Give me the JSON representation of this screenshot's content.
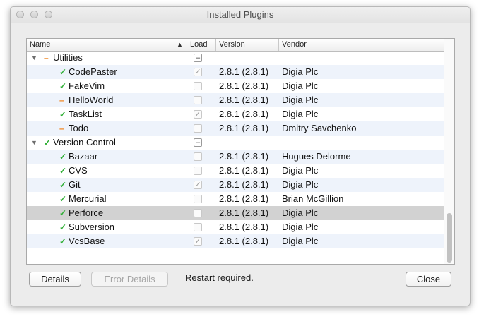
{
  "window": {
    "title": "Installed Plugins"
  },
  "columns": {
    "name": "Name",
    "load": "Load",
    "version": "Version",
    "vendor": "Vendor"
  },
  "rows": [
    {
      "type": "category",
      "name": "Utilities",
      "status": "partial",
      "status_glyph": "–",
      "load": "partial",
      "load_glyph": "–",
      "version": "",
      "vendor": ""
    },
    {
      "type": "plugin",
      "name": "CodePaster",
      "status": "ok",
      "status_glyph": "✓",
      "load": "checked",
      "load_glyph": "✓",
      "version": "2.8.1 (2.8.1)",
      "vendor": "Digia Plc"
    },
    {
      "type": "plugin",
      "name": "FakeVim",
      "status": "ok",
      "status_glyph": "✓",
      "load": "unchecked",
      "load_glyph": "",
      "version": "2.8.1 (2.8.1)",
      "vendor": "Digia Plc"
    },
    {
      "type": "plugin",
      "name": "HelloWorld",
      "status": "disabled",
      "status_glyph": "–",
      "load": "unchecked",
      "load_glyph": "",
      "version": "2.8.1 (2.8.1)",
      "vendor": "Digia Plc"
    },
    {
      "type": "plugin",
      "name": "TaskList",
      "status": "ok",
      "status_glyph": "✓",
      "load": "checked",
      "load_glyph": "✓",
      "version": "2.8.1 (2.8.1)",
      "vendor": "Digia Plc"
    },
    {
      "type": "plugin",
      "name": "Todo",
      "status": "disabled",
      "status_glyph": "–",
      "load": "unchecked",
      "load_glyph": "",
      "version": "2.8.1 (2.8.1)",
      "vendor": "Dmitry Savchenko"
    },
    {
      "type": "category",
      "name": "Version Control",
      "status": "ok",
      "status_glyph": "✓",
      "load": "partial",
      "load_glyph": "–",
      "version": "",
      "vendor": ""
    },
    {
      "type": "plugin",
      "name": "Bazaar",
      "status": "ok",
      "status_glyph": "✓",
      "load": "unchecked",
      "load_glyph": "",
      "version": "2.8.1 (2.8.1)",
      "vendor": "Hugues Delorme"
    },
    {
      "type": "plugin",
      "name": "CVS",
      "status": "ok",
      "status_glyph": "✓",
      "load": "unchecked",
      "load_glyph": "",
      "version": "2.8.1 (2.8.1)",
      "vendor": "Digia Plc"
    },
    {
      "type": "plugin",
      "name": "Git",
      "status": "ok",
      "status_glyph": "✓",
      "load": "checked",
      "load_glyph": "✓",
      "version": "2.8.1 (2.8.1)",
      "vendor": "Digia Plc"
    },
    {
      "type": "plugin",
      "name": "Mercurial",
      "status": "ok",
      "status_glyph": "✓",
      "load": "unchecked",
      "load_glyph": "",
      "version": "2.8.1 (2.8.1)",
      "vendor": "Brian McGillion"
    },
    {
      "type": "plugin",
      "name": "Perforce",
      "status": "ok",
      "status_glyph": "✓",
      "load": "unchecked",
      "load_glyph": "",
      "version": "2.8.1 (2.8.1)",
      "vendor": "Digia Plc",
      "selected": true
    },
    {
      "type": "plugin",
      "name": "Subversion",
      "status": "ok",
      "status_glyph": "✓",
      "load": "unchecked",
      "load_glyph": "",
      "version": "2.8.1 (2.8.1)",
      "vendor": "Digia Plc"
    },
    {
      "type": "plugin",
      "name": "VcsBase",
      "status": "ok",
      "status_glyph": "✓",
      "load": "checked",
      "load_glyph": "✓",
      "version": "2.8.1 (2.8.1)",
      "vendor": "Digia Plc"
    }
  ],
  "buttons": {
    "details": "Details",
    "error_details": "Error Details",
    "close": "Close"
  },
  "status_text": "Restart required.",
  "colors": {
    "ok": "#2eae34",
    "disabled": "#f0841e",
    "selection": "#d2d2d2",
    "alt_row": "#eef3fb"
  }
}
